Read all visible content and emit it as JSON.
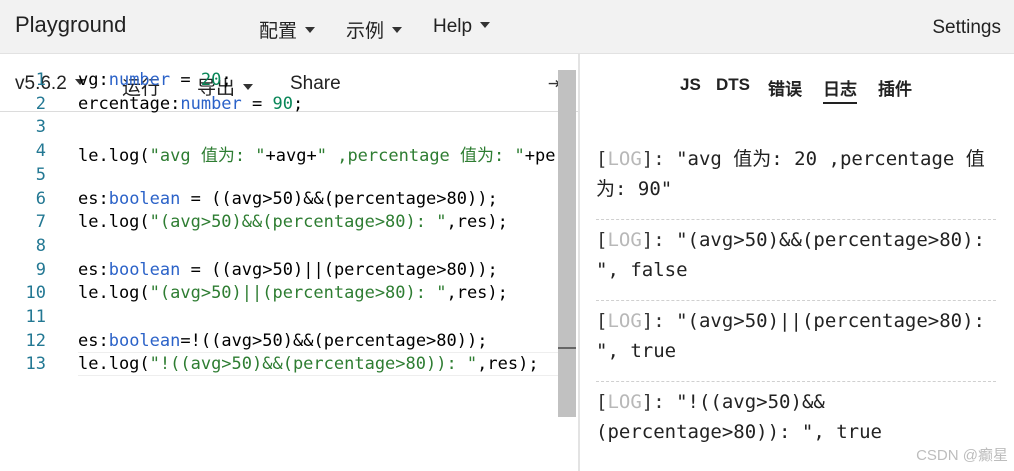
{
  "nav": {
    "brand": "Playground",
    "menus": [
      "配置",
      "示例",
      "Help"
    ],
    "settings": "Settings"
  },
  "toolbar": {
    "version": "v5.6.2",
    "run": "运行",
    "export": "导出",
    "share": "Share",
    "toggle_icon": "⇥"
  },
  "editor": {
    "line_numbers": [
      "1",
      "2",
      "3",
      "4",
      "5",
      "6",
      "7",
      "8",
      "9",
      "10",
      "11",
      "12",
      "13"
    ],
    "current_line": 13,
    "lines": [
      [
        {
          "t": "vg:"
        },
        {
          "t": "number",
          "c": "kw"
        },
        {
          "t": " = "
        },
        {
          "t": "20",
          "c": "num"
        },
        {
          "t": ";"
        }
      ],
      [
        {
          "t": "ercentage:"
        },
        {
          "t": "number",
          "c": "kw"
        },
        {
          "t": " = "
        },
        {
          "t": "90",
          "c": "num"
        },
        {
          "t": ";"
        }
      ],
      [],
      [
        {
          "t": "le.log("
        },
        {
          "t": "\"avg 值为: \"",
          "c": "str-g"
        },
        {
          "t": "+avg+"
        },
        {
          "t": "\" ,percentage 值为: \"",
          "c": "str-g"
        },
        {
          "t": "+perc"
        }
      ],
      [],
      [
        {
          "t": "es:"
        },
        {
          "t": "boolean",
          "c": "kw"
        },
        {
          "t": " = (("
        },
        {
          "t": "avg>50"
        },
        {
          "t": ")&&("
        },
        {
          "t": "percentage>80"
        },
        {
          "t": "));"
        }
      ],
      [
        {
          "t": "le.log("
        },
        {
          "t": "\"(avg>50)&&(percentage>80): \"",
          "c": "str-g"
        },
        {
          "t": ",res);"
        }
      ],
      [],
      [
        {
          "t": "es:"
        },
        {
          "t": "boolean",
          "c": "kw"
        },
        {
          "t": " = (("
        },
        {
          "t": "avg>50"
        },
        {
          "t": ")||("
        },
        {
          "t": "percentage>80"
        },
        {
          "t": "));"
        }
      ],
      [
        {
          "t": "le.log("
        },
        {
          "t": "\"(avg>50)||(percentage>80): \"",
          "c": "str-g"
        },
        {
          "t": ",res);"
        }
      ],
      [],
      [
        {
          "t": "es:"
        },
        {
          "t": "boolean",
          "c": "kw"
        },
        {
          "t": "=!(("
        },
        {
          "t": "avg>50"
        },
        {
          "t": ")&&("
        },
        {
          "t": "percentage>80"
        },
        {
          "t": "));"
        }
      ],
      [
        {
          "t": "le.log("
        },
        {
          "t": "\"!((avg>50)&&(percentage>80)): \"",
          "c": "str-g"
        },
        {
          "t": ",res);"
        }
      ]
    ]
  },
  "sidebar": {
    "tabs": [
      "JS",
      "DTS",
      "错误",
      "日志",
      "插件"
    ],
    "active_tab": "日志",
    "logs": [
      {
        "tag": "LOG",
        "line1": "\"avg 值为: 20 ,percentage 值",
        "line2": "为: 90\""
      },
      {
        "tag": "LOG",
        "line1": "\"(avg>50)&&(percentage>80):",
        "line2": "\",  false"
      },
      {
        "tag": "LOG",
        "line1": "\"(avg>50)||(percentage>80):",
        "line2": "\",  true"
      },
      {
        "tag": "LOG",
        "line1": "\"!((avg>50)&&",
        "line2": "(percentage>80)): \",  true"
      }
    ]
  },
  "watermark": "CSDN @癫星"
}
